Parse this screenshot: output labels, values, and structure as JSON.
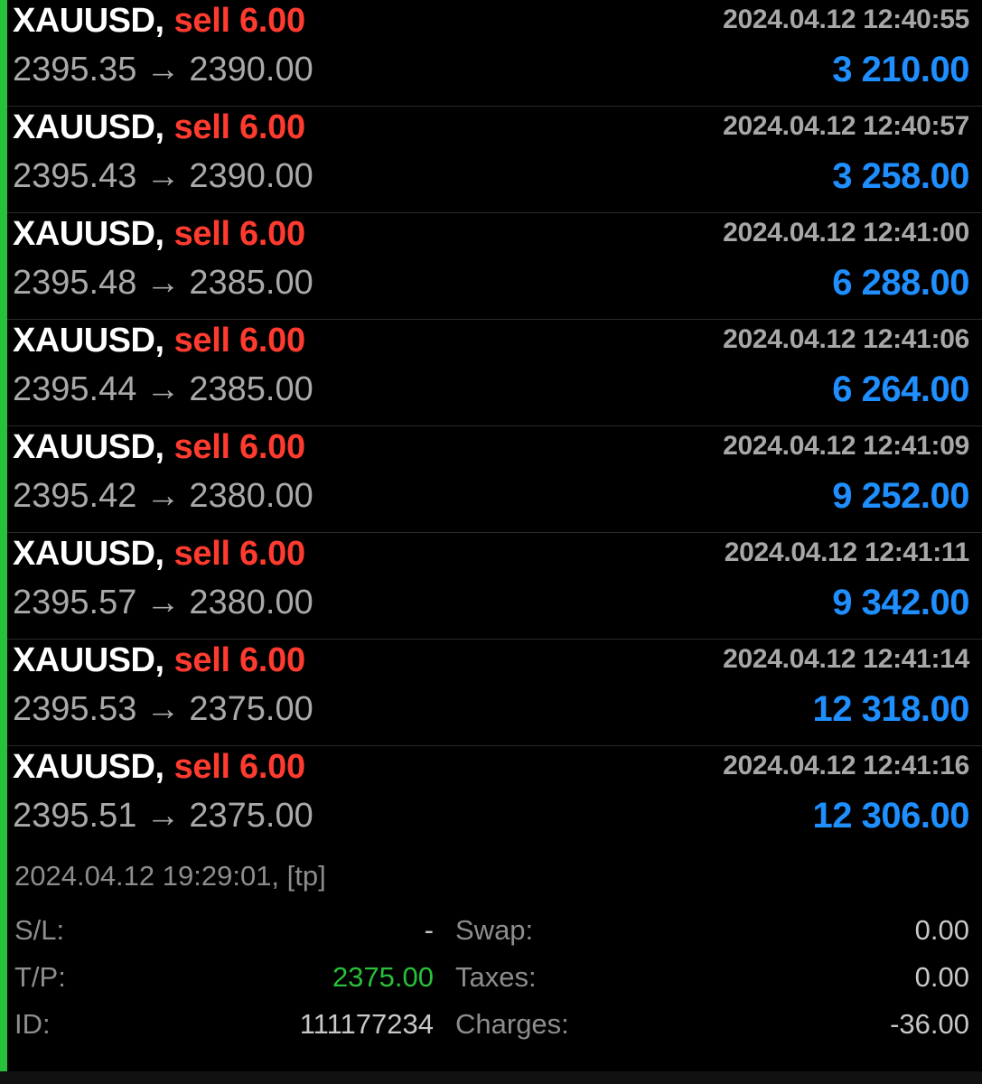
{
  "trades": [
    {
      "symbol": "XAUUSD",
      "side": "sell 6.00",
      "time": "2024.04.12 12:40:55",
      "open_price": "2395.35",
      "close_price": "2390.00",
      "profit": "3 210.00"
    },
    {
      "symbol": "XAUUSD",
      "side": "sell 6.00",
      "time": "2024.04.12 12:40:57",
      "open_price": "2395.43",
      "close_price": "2390.00",
      "profit": "3 258.00"
    },
    {
      "symbol": "XAUUSD",
      "side": "sell 6.00",
      "time": "2024.04.12 12:41:00",
      "open_price": "2395.48",
      "close_price": "2385.00",
      "profit": "6 288.00"
    },
    {
      "symbol": "XAUUSD",
      "side": "sell 6.00",
      "time": "2024.04.12 12:41:06",
      "open_price": "2395.44",
      "close_price": "2385.00",
      "profit": "6 264.00"
    },
    {
      "symbol": "XAUUSD",
      "side": "sell 6.00",
      "time": "2024.04.12 12:41:09",
      "open_price": "2395.42",
      "close_price": "2380.00",
      "profit": "9 252.00"
    },
    {
      "symbol": "XAUUSD",
      "side": "sell 6.00",
      "time": "2024.04.12 12:41:11",
      "open_price": "2395.57",
      "close_price": "2380.00",
      "profit": "9 342.00"
    },
    {
      "symbol": "XAUUSD",
      "side": "sell 6.00",
      "time": "2024.04.12 12:41:14",
      "open_price": "2395.53",
      "close_price": "2375.00",
      "profit": "12 318.00"
    },
    {
      "symbol": "XAUUSD",
      "side": "sell 6.00",
      "time": "2024.04.12 12:41:16",
      "open_price": "2395.51",
      "close_price": "2375.00",
      "profit": "12 306.00"
    }
  ],
  "arrow": "→",
  "comma": ",",
  "details": {
    "close_info": "2024.04.12 19:29:01, [tp]",
    "sl_label": "S/L:",
    "sl_value": "-",
    "tp_label": "T/P:",
    "tp_value": "2375.00",
    "id_label": "ID:",
    "id_value": "111177234",
    "swap_label": "Swap:",
    "swap_value": "0.00",
    "taxes_label": "Taxes:",
    "taxes_value": "0.00",
    "charges_label": "Charges:",
    "charges_value": "-36.00"
  },
  "colors": {
    "background": "#000000",
    "accent_green": "#27c13a",
    "sell_red": "#ff3b30",
    "profit_blue": "#1f8fff",
    "muted_text": "#a9a9a9"
  }
}
